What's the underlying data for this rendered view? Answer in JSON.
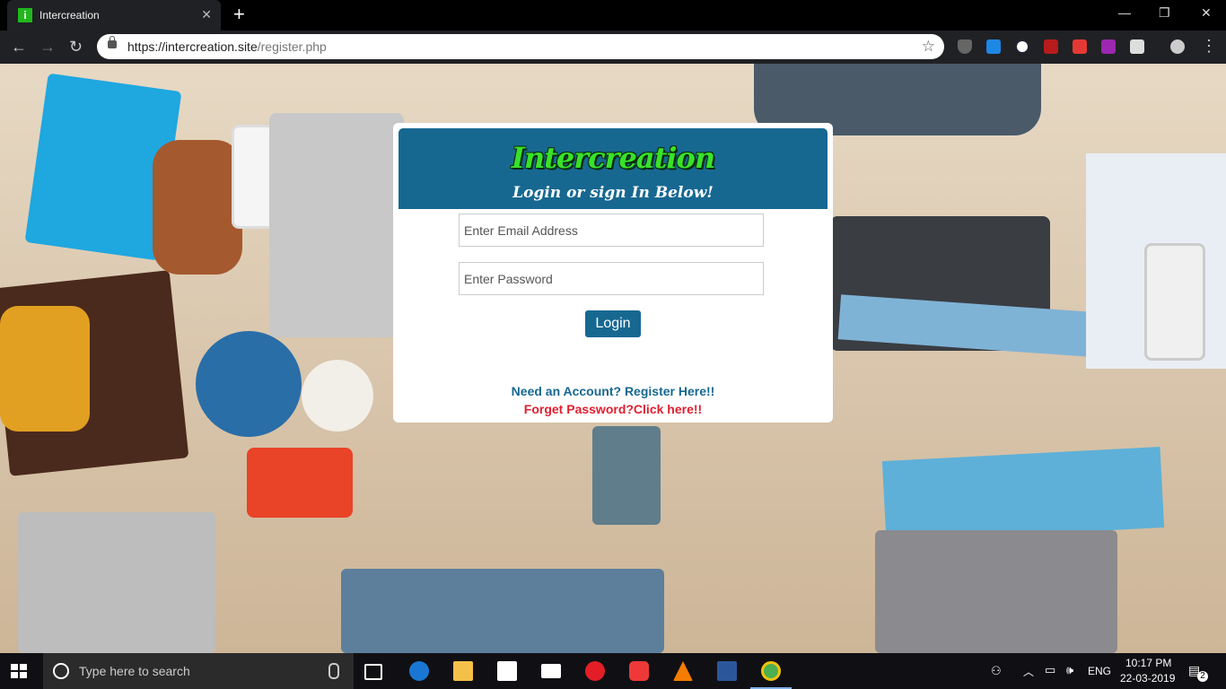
{
  "browser": {
    "tab_title": "Intercreation",
    "favicon_letter": "i",
    "url_host": "https://intercreation.site",
    "url_path": "/register.php"
  },
  "card": {
    "brand": "Intercreation",
    "subtitle": "Login or sign In Below!",
    "email_placeholder": "Enter Email Address",
    "password_placeholder": "Enter Password",
    "login_label": "Login",
    "register_text": "Need an Account? Register Here!!",
    "forgot_text": "Forget Password?Click here!!"
  },
  "taskbar": {
    "search_placeholder": "Type here to search",
    "language": "ENG",
    "time": "10:17 PM",
    "date": "22-03-2019",
    "notification_count": "2"
  },
  "colors": {
    "header_blue": "#176891",
    "brand_green": "#39e12a",
    "forgot_red": "#e01f2f"
  }
}
